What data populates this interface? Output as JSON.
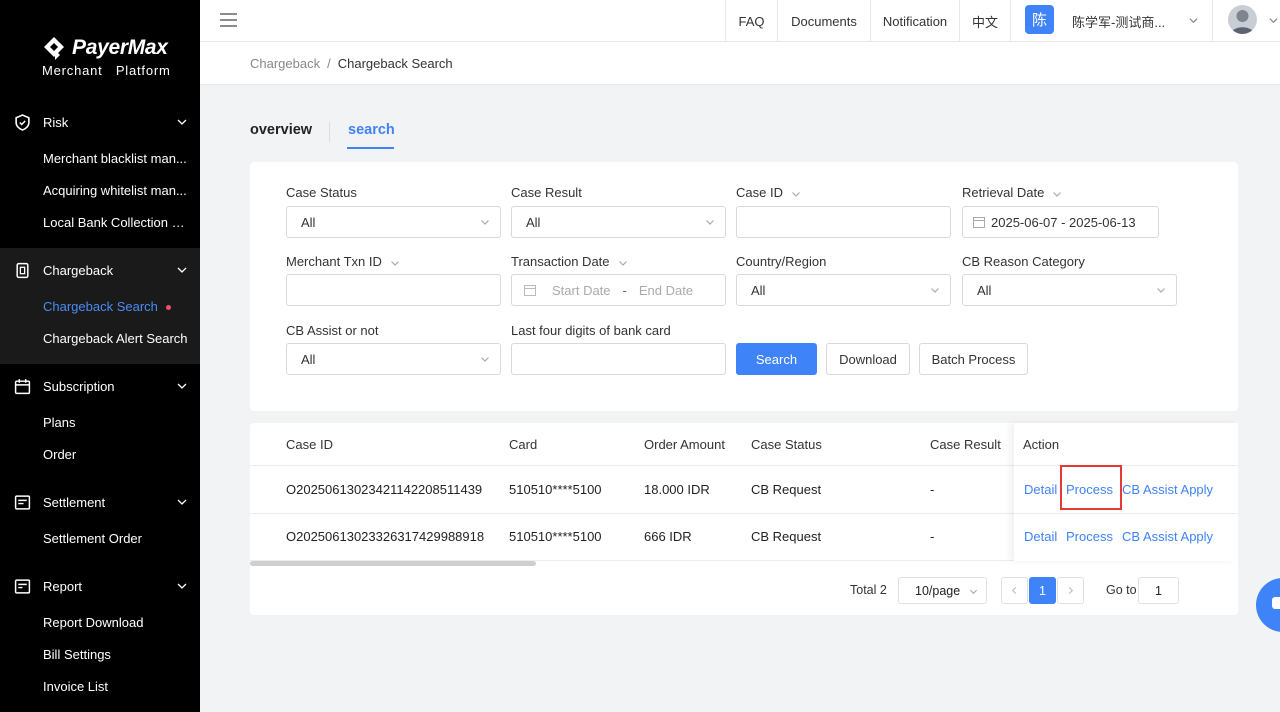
{
  "brand": {
    "name": "PayerMax",
    "subtitle": "Merchant   Platform"
  },
  "sidebar": {
    "risk_label": "Risk",
    "risk_items": [
      "Merchant blacklist man...",
      "Acquiring whitelist man...",
      "Local Bank Collection List"
    ],
    "chargeback": {
      "label": "Chargeback",
      "items": [
        "Chargeback Search",
        "Chargeback Alert Search"
      ]
    },
    "subscription": {
      "label": "Subscription",
      "items": [
        "Plans",
        "Order"
      ]
    },
    "settlement": {
      "label": "Settlement",
      "items": [
        "Settlement Order"
      ]
    },
    "report": {
      "label": "Report",
      "items": [
        "Report Download",
        "Bill Settings",
        "Invoice List"
      ]
    }
  },
  "header": {
    "nav": [
      "FAQ",
      "Documents",
      "Notification",
      "中文"
    ],
    "avatar_letter": "陈",
    "user_name": "陈学军-测试商..."
  },
  "breadcrumb": {
    "parent": "Chargeback",
    "separator": "/",
    "current": "Chargeback Search"
  },
  "tabs": {
    "overview": "overview",
    "search": "search"
  },
  "filters": {
    "case_status": {
      "label": "Case Status",
      "value": "All"
    },
    "case_result": {
      "label": "Case Result",
      "value": "All"
    },
    "case_id": {
      "label": "Case ID",
      "value": ""
    },
    "retrieval_date": {
      "label": "Retrieval Date",
      "value": "2025-06-07 - 2025-06-13"
    },
    "merchant_txn_id": {
      "label": "Merchant Txn ID",
      "value": ""
    },
    "transaction_date": {
      "label": "Transaction Date",
      "start_placeholder": "Start Date",
      "separator": "-",
      "end_placeholder": "End Date"
    },
    "country_region": {
      "label": "Country/Region",
      "value": "All"
    },
    "cb_reason_category": {
      "label": "CB Reason Category",
      "value": "All"
    },
    "cb_assist": {
      "label": "CB Assist or not",
      "value": "All"
    },
    "last_four": {
      "label": "Last four digits of bank card",
      "value": ""
    }
  },
  "buttons": {
    "search": "Search",
    "download": "Download",
    "batch_process": "Batch Process"
  },
  "table": {
    "columns": [
      "Case ID",
      "Card",
      "Order Amount",
      "Case Status",
      "Case Result",
      "Action"
    ],
    "rows": [
      {
        "case_id": "O20250613023421142208511439",
        "card": "510510****5100",
        "amount": "18.000 IDR",
        "status": "CB Request",
        "result": "-"
      },
      {
        "case_id": "O20250613023326317429988918",
        "card": "510510****5100",
        "amount": "666 IDR",
        "status": "CB Request",
        "result": "-"
      }
    ],
    "actions": {
      "detail": "Detail",
      "process": "Process",
      "assist": "CB Assist Apply"
    }
  },
  "pagination": {
    "total": "Total 2",
    "page_size": "10/page",
    "current_page": "1",
    "goto_label": "Go to",
    "goto_value": "1"
  },
  "colors": {
    "accent": "#3f83f8",
    "sidebar_bg": "#000000",
    "highlight_box": "#e53935",
    "dot": "#f0506e"
  }
}
